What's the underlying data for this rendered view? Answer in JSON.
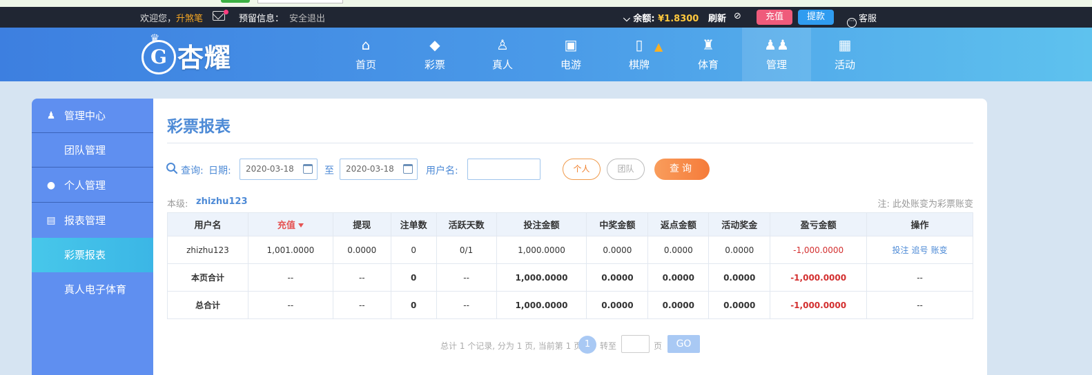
{
  "topbar": {
    "welcome": "欢迎您，",
    "username": "升煞笔",
    "reserve_info": "预留信息：",
    "logout": "安全退出",
    "balance_label": "余额:",
    "balance_value": "¥1.8300",
    "refresh": "刷新",
    "deposit": "充值",
    "withdraw": "提款",
    "service": "客服"
  },
  "logo": {
    "text": "杏耀"
  },
  "nav": {
    "items": [
      {
        "label": "首页",
        "icon": "home-icon"
      },
      {
        "label": "彩票",
        "icon": "lottery-icon"
      },
      {
        "label": "真人",
        "icon": "live-dealer-icon"
      },
      {
        "label": "电游",
        "icon": "slot-machine-icon"
      },
      {
        "label": "棋牌",
        "icon": "card-icon"
      },
      {
        "label": "体育",
        "icon": "trophy-icon"
      },
      {
        "label": "管理",
        "icon": "users-icon"
      },
      {
        "label": "活动",
        "icon": "gift-icon"
      }
    ],
    "active": "管理"
  },
  "sidebar": {
    "items": [
      {
        "label": "管理中心",
        "icon": "users-icon",
        "type": "group"
      },
      {
        "label": "团队管理",
        "type": "sub"
      },
      {
        "label": "个人管理",
        "icon": "user-icon",
        "type": "group"
      },
      {
        "label": "报表管理",
        "icon": "document-icon",
        "type": "group"
      },
      {
        "label": "彩票报表",
        "type": "sub",
        "active": true
      },
      {
        "label": "真人电子体育",
        "type": "sub"
      }
    ]
  },
  "report": {
    "title": "彩票报表",
    "query_label": "查询:",
    "date_label": "日期:",
    "date_from": "2020-03-18",
    "date_sep": "至",
    "date_to": "2020-03-18",
    "username_label": "用户名:",
    "username_value": "",
    "btn_person": "个人",
    "btn_team": "团队",
    "btn_query": "查询",
    "level_label": "本级:",
    "level_value": "zhizhu123",
    "note": "注: 此处账变为彩票账变"
  },
  "table": {
    "headers": [
      "用户名",
      "充值",
      "提现",
      "注单数",
      "活跃天数",
      "投注金额",
      "中奖金额",
      "返点金额",
      "活动奖金",
      "盈亏金额",
      "操作"
    ],
    "rows": [
      [
        "zhizhu123",
        "1,001.0000",
        "0.0000",
        "0",
        "0/1",
        "1,000.0000",
        "0.0000",
        "0.0000",
        "0.0000",
        "-1,000.0000",
        ""
      ],
      [
        "本页合计",
        "--",
        "--",
        "0",
        "--",
        "1,000.0000",
        "0.0000",
        "0.0000",
        "0.0000",
        "-1,000.0000",
        "--"
      ],
      [
        "总合计",
        "--",
        "--",
        "0",
        "--",
        "1,000.0000",
        "0.0000",
        "0.0000",
        "0.0000",
        "-1,000.0000",
        "--"
      ]
    ],
    "ops": [
      "投注",
      "追号",
      "账变"
    ]
  },
  "pager": {
    "info": "总计 1 个记录, 分为 1 页, 当前第 1 页",
    "current": "1",
    "jump_label": "转至",
    "page_label": "页",
    "go": "GO"
  },
  "colors": {
    "accent": "#4d8ad6",
    "sidebar": "#5f8ff0",
    "negative": "#d32f2f",
    "query_button": "#f57b3a"
  }
}
